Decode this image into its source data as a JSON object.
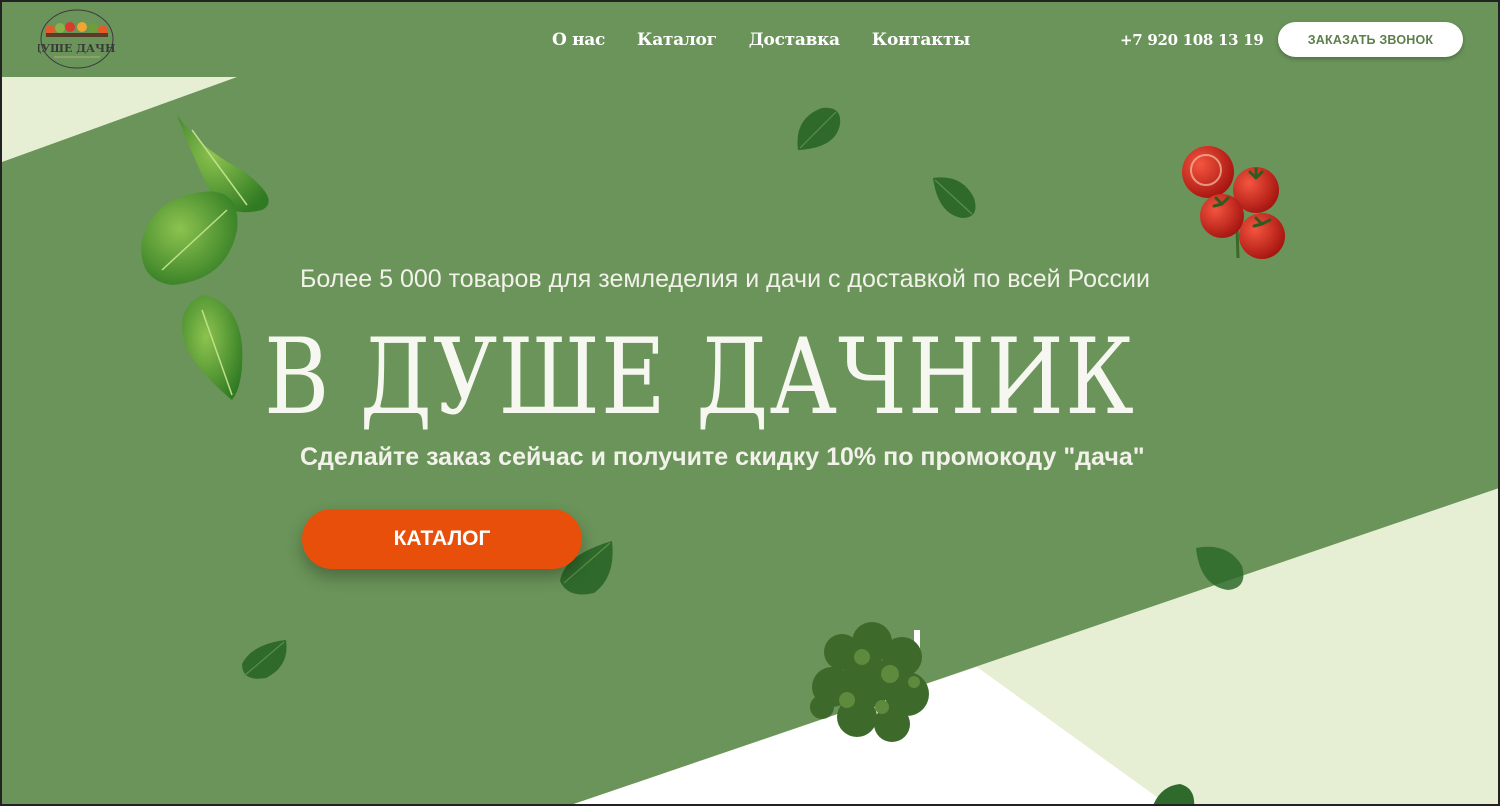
{
  "header": {
    "logo_alt": "В душе дачник",
    "nav": [
      "О нас",
      "Каталог",
      "Доставка",
      "Контакты"
    ],
    "phone": "+7 920 108 13 19",
    "call_button": "ЗАКАЗАТЬ ЗВОНОК"
  },
  "hero": {
    "subtitle": "Более 5 000 товаров для земледелия и дачи с доставкой по всей России",
    "title": "В ДУШЕ ДАЧНИК",
    "promo": "Сделайте заказ сейчас и получите скидку 10% по промокоду \"дача\"",
    "catalog_button": "КАТАЛОГ"
  },
  "colors": {
    "background": "#6a9459",
    "pale_green": "#e6eed4",
    "accent_orange": "#e84f0a",
    "leaf_dark": "#2f6a2c",
    "tomato_red": "#c8241c"
  },
  "icons": [
    "logo-basket-icon",
    "spinach-leaf-icon",
    "tomato-icon",
    "parsley-plant-icon"
  ]
}
